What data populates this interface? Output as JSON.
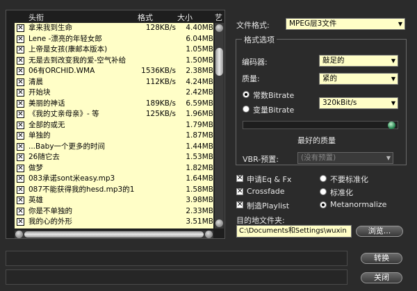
{
  "list": {
    "columns": {
      "title": "头衔",
      "format": "格式",
      "size": "大小",
      "artist": "艺"
    },
    "rows": [
      {
        "title": "拿来我到生命",
        "format": "128KB/s",
        "size": "4.40MB"
      },
      {
        "title": "Lene -漂亮的年轻女郎",
        "format": "",
        "size": "6.04MB"
      },
      {
        "title": "上帝是女孩(康邮本版本)",
        "format": "",
        "size": "1.05MB"
      },
      {
        "title": "无是去到改变我的爱-空气补给",
        "format": "",
        "size": "1.50MB"
      },
      {
        "title": "06有ORCHID.WMA",
        "format": "1536KB/s",
        "size": "2.38MB"
      },
      {
        "title": "清晨",
        "format": "112KB/s",
        "size": "4.24MB"
      },
      {
        "title": "开始块",
        "format": "",
        "size": "2.42MB"
      },
      {
        "title": "美丽的神话",
        "format": "189KB/s",
        "size": "6.59MB"
      },
      {
        "title": "《我的丈亲母亲》- 等",
        "format": "125KB/s",
        "size": "1.96MB"
      },
      {
        "title": "全部的或无",
        "format": "",
        "size": "1.79MB"
      },
      {
        "title": "单独的",
        "format": "",
        "size": "1.87MB"
      },
      {
        "title": "...Baby一个更多的时间",
        "format": "",
        "size": "1.44MB"
      },
      {
        "title": "26随它去",
        "format": "",
        "size": "1.53MB"
      },
      {
        "title": "做梦",
        "format": "",
        "size": "1.82MB"
      },
      {
        "title": "083承诺sont米easy.mp3",
        "format": "",
        "size": "1.64MB"
      },
      {
        "title": "087不能获得我的hesd.mp3的1",
        "format": "",
        "size": "1.58MB"
      },
      {
        "title": "英雄",
        "format": "",
        "size": "3.98MB"
      },
      {
        "title": "你是不单独的",
        "format": "",
        "size": "2.33MB"
      },
      {
        "title": "我的心的外形",
        "format": "",
        "size": "3.51MB"
      }
    ]
  },
  "panel": {
    "format_label": "文件格式:",
    "format_value": "MPEG层3文件",
    "group_title": "格式选项",
    "encoder_label": "编码器:",
    "encoder_value": "敲足的",
    "quality_label": "质量:",
    "quality_value": "紧的",
    "constant_label": "常数Bitrate",
    "variable_label": "变量Bitrate",
    "bitrate_value": "320kBit/s",
    "best_quality": "最好的质量",
    "vbr_label": "VBR-预置:",
    "vbr_value": "(没有预置)",
    "opt_eq": "申请Eq & Fx",
    "opt_crossfade": "Crossfade",
    "opt_playlist": "制造Playlist",
    "opt_no_normalize": "不要标准化",
    "opt_normalize": "标准化",
    "opt_metanormalize": "Metanormalize",
    "dest_label": "目的地文件夹:",
    "dest_value": "C:\\Documents和Settings\\wuxin",
    "browse": "浏览...",
    "convert": "转换",
    "close": "关闭"
  }
}
